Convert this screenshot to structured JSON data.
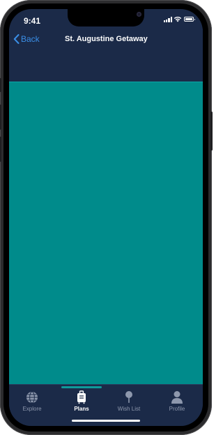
{
  "status_bar": {
    "time": "9:41"
  },
  "header": {
    "back_label": "Back",
    "title": "St. Augustine Getaway"
  },
  "colors": {
    "nav_bg": "#1b2a48",
    "content_bg": "#008b8b",
    "accent": "#3a8ee6",
    "tab_indicator": "#0f9a9a"
  },
  "tabs": [
    {
      "label": "Explore",
      "icon": "globe-icon",
      "active": false
    },
    {
      "label": "Plans",
      "icon": "suitcase-icon",
      "active": true
    },
    {
      "label": "Wish List",
      "icon": "pin-icon",
      "active": false
    },
    {
      "label": "Profile",
      "icon": "person-icon",
      "active": false
    }
  ]
}
